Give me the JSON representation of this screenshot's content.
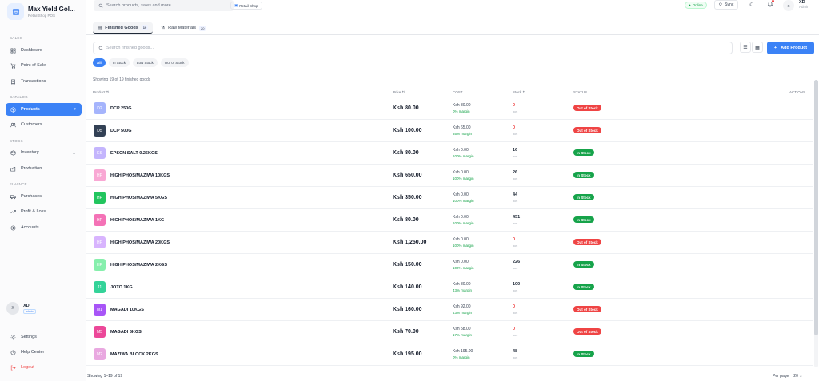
{
  "brand": {
    "name": "Max Yield Gol...",
    "subtitle": "Retail Shop POS",
    "logo_icon": "store-icon"
  },
  "sidebar": {
    "sections": {
      "sales": "SALES",
      "catalog": "CATALOG",
      "stock": "STOCK",
      "finance": "FINANCE"
    },
    "items": [
      {
        "label": "Dashboard",
        "icon": "dashboard-icon"
      },
      {
        "label": "Point of Sale",
        "icon": "cart-icon"
      },
      {
        "label": "Transactions",
        "icon": "receipt-icon"
      },
      {
        "label": "Products",
        "icon": "box-icon",
        "active": true
      },
      {
        "label": "Customers",
        "icon": "users-icon"
      },
      {
        "label": "Inventory",
        "icon": "inventory-icon"
      },
      {
        "label": "Production",
        "icon": "factory-icon"
      },
      {
        "label": "Purchases",
        "icon": "truck-icon"
      },
      {
        "label": "Profit & Loss",
        "icon": "trend-icon"
      },
      {
        "label": "Accounts",
        "icon": "accounts-icon"
      },
      {
        "label": "Settings",
        "icon": "gear-icon"
      },
      {
        "label": "Help Center",
        "icon": "help-icon"
      },
      {
        "label": "Logout",
        "icon": "logout-icon"
      }
    ],
    "user": {
      "initial": "X",
      "name": "XD",
      "role": "admin"
    }
  },
  "topbar": {
    "search_placeholder": "Search products, sales and more",
    "shop_label": "Retail Shop",
    "online_label": "Online",
    "sync_label": "Sync",
    "user_initial": "X",
    "user_name": "XD",
    "user_role": "Admin"
  },
  "tabs": [
    {
      "label": "Finished Goods",
      "count": "19",
      "active": true
    },
    {
      "label": "Raw Materials",
      "count": "20",
      "active": false
    }
  ],
  "filters": {
    "search_placeholder": "Search finished goods...",
    "pills": [
      "All",
      "In Stock",
      "Low Stock",
      "Out of Stock"
    ],
    "add_label": "Add Product",
    "showing_text": "Showing 19 of 19 finished goods"
  },
  "table": {
    "headers": {
      "product": "Product ⇅",
      "price": "Price ⇅",
      "cost": "COST",
      "stock": "Stock ⇅",
      "status": "STATUS",
      "actions": "ACTIONS"
    },
    "rows": [
      {
        "initials": "D2",
        "color": "#a5b4fc",
        "name": "DCP 250G",
        "price": "Ksh 80.00",
        "cost": "Ksh 80.00",
        "margin": "0% margin",
        "stock": "0",
        "unit": "pcs",
        "status": "Out of Stock"
      },
      {
        "initials": "D5",
        "color": "#334155",
        "name": "DCP 500G",
        "price": "Ksh 100.00",
        "cost": "Ksh 65.00",
        "margin": "35% margin",
        "stock": "0",
        "unit": "pcs",
        "status": "Out of Stock"
      },
      {
        "initials": "ES",
        "color": "#c4b5fd",
        "name": "EPSON SALT 0.25KGS",
        "price": "Ksh 80.00",
        "cost": "Ksh 0.00",
        "margin": "100% margin",
        "stock": "16",
        "unit": "pcs",
        "status": "In Stock"
      },
      {
        "initials": "HP",
        "color": "#f9a8d4",
        "name": "HIGH PHOS/MAZIWA 10KGS",
        "price": "Ksh 650.00",
        "cost": "Ksh 0.00",
        "margin": "100% margin",
        "stock": "26",
        "unit": "pcs",
        "status": "In Stock"
      },
      {
        "initials": "HP",
        "color": "#22c55e",
        "name": "HIGH PHOS/MAZIWA 5KGS",
        "price": "Ksh 350.00",
        "cost": "Ksh 0.00",
        "margin": "100% margin",
        "stock": "44",
        "unit": "pcs",
        "status": "In Stock"
      },
      {
        "initials": "HP",
        "color": "#f472b6",
        "name": "HIGH PHOS/MAZIWA 1KG",
        "price": "Ksh 80.00",
        "cost": "Ksh 0.00",
        "margin": "100% margin",
        "stock": "451",
        "unit": "pcs",
        "status": "In Stock"
      },
      {
        "initials": "HP",
        "color": "#d8b4fe",
        "name": "HIGH PHOS/MAZIWA 20KGS",
        "price": "Ksh 1,250.00",
        "cost": "Ksh 0.00",
        "margin": "100% margin",
        "stock": "0",
        "unit": "pcs",
        "status": "Out of Stock"
      },
      {
        "initials": "HP",
        "color": "#86efac",
        "name": "HIGH PHOS/MAZIWA 2KGS",
        "price": "Ksh 150.00",
        "cost": "Ksh 0.00",
        "margin": "100% margin",
        "stock": "226",
        "unit": "pcs",
        "status": "In Stock"
      },
      {
        "initials": "J1",
        "color": "#34d399",
        "name": "JOTO 1KG",
        "price": "Ksh 140.00",
        "cost": "Ksh 80.00",
        "margin": "43% margin",
        "stock": "100",
        "unit": "pcs",
        "status": "In Stock"
      },
      {
        "initials": "M1",
        "color": "#a855f7",
        "name": "MAGADI 10KGS",
        "price": "Ksh 160.00",
        "cost": "Ksh 92.00",
        "margin": "43% margin",
        "stock": "0",
        "unit": "pcs",
        "status": "Out of Stock"
      },
      {
        "initials": "M5",
        "color": "#ec4899",
        "name": "MAGADI 5KGS",
        "price": "Ksh 70.00",
        "cost": "Ksh 58.00",
        "margin": "17% margin",
        "stock": "0",
        "unit": "pcs",
        "status": "Out of Stock"
      },
      {
        "initials": "M2",
        "color": "#e9a8e0",
        "name": "MAZIWA BLOCK 2KGS",
        "price": "Ksh 195.00",
        "cost": "Ksh 195.00",
        "margin": "0% margin",
        "stock": "48",
        "unit": "pcs",
        "status": "In Stock"
      }
    ]
  },
  "footer": {
    "showing": "Showing 1–19 of 19",
    "per_page_label": "Per page",
    "per_page_value": "20"
  },
  "colors": {
    "accent": "#3b82f6",
    "in_stock": "#16a34a",
    "out_of_stock": "#ef4444"
  }
}
